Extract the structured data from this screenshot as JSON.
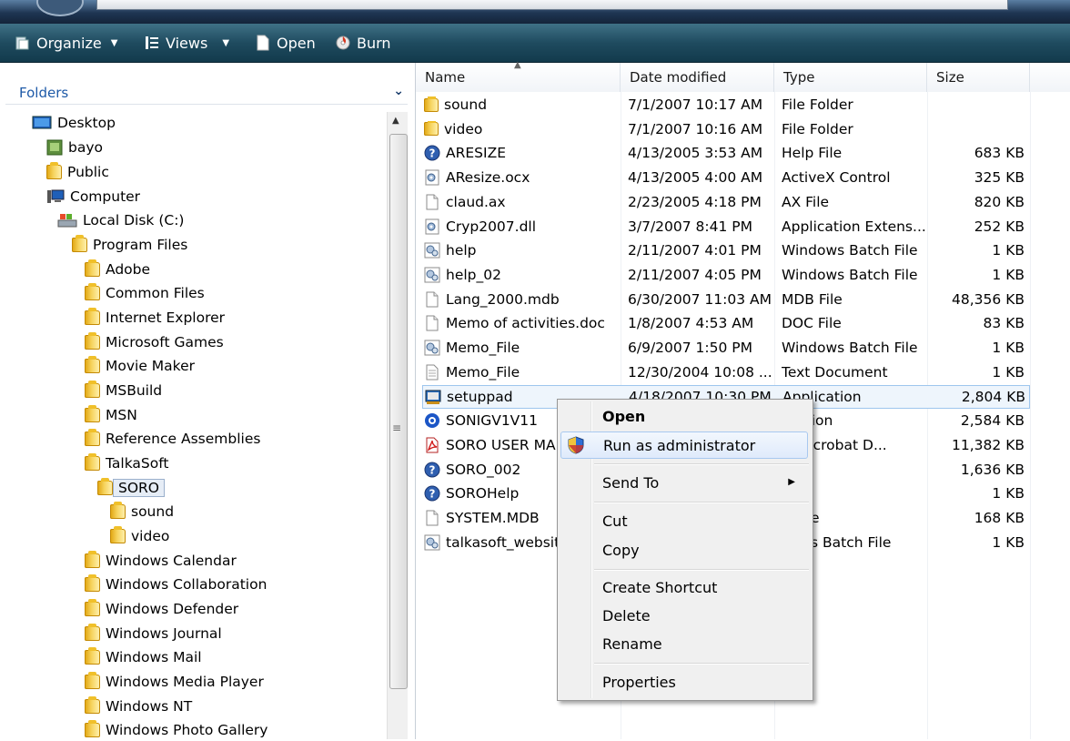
{
  "toolbar": {
    "organize": "Organize",
    "views": "Views",
    "open": "Open",
    "burn": "Burn"
  },
  "nav": {
    "header": "Folders",
    "items": [
      {
        "label": "Desktop",
        "icon": "desktop-icon"
      },
      {
        "label": "bayo",
        "icon": "user-icon"
      },
      {
        "label": "Public",
        "icon": "folder-icon"
      },
      {
        "label": "Computer",
        "icon": "computer-icon"
      },
      {
        "label": "Local Disk (C:)",
        "icon": "drive-icon"
      },
      {
        "label": "Program Files",
        "icon": "folder-icon"
      },
      {
        "label": "Adobe",
        "icon": "folder-icon"
      },
      {
        "label": "Common Files",
        "icon": "folder-icon"
      },
      {
        "label": "Internet Explorer",
        "icon": "folder-icon"
      },
      {
        "label": "Microsoft Games",
        "icon": "folder-icon"
      },
      {
        "label": "Movie Maker",
        "icon": "folder-icon"
      },
      {
        "label": "MSBuild",
        "icon": "folder-icon"
      },
      {
        "label": "MSN",
        "icon": "folder-icon"
      },
      {
        "label": "Reference Assemblies",
        "icon": "folder-icon"
      },
      {
        "label": "TalkaSoft",
        "icon": "folder-icon"
      },
      {
        "label": "SORO",
        "icon": "folder-icon"
      },
      {
        "label": "sound",
        "icon": "folder-icon"
      },
      {
        "label": "video",
        "icon": "folder-icon"
      },
      {
        "label": "Windows Calendar",
        "icon": "folder-icon"
      },
      {
        "label": "Windows Collaboration",
        "icon": "folder-icon"
      },
      {
        "label": "Windows Defender",
        "icon": "folder-icon"
      },
      {
        "label": "Windows Journal",
        "icon": "folder-icon"
      },
      {
        "label": "Windows Mail",
        "icon": "folder-icon"
      },
      {
        "label": "Windows Media Player",
        "icon": "folder-icon"
      },
      {
        "label": "Windows NT",
        "icon": "folder-icon"
      },
      {
        "label": "Windows Photo Gallery",
        "icon": "folder-icon"
      }
    ]
  },
  "columns": {
    "name": "Name",
    "date": "Date modified",
    "type": "Type",
    "size": "Size"
  },
  "files": [
    {
      "name": "sound",
      "date": "7/1/2007 10:17 AM",
      "type": "File Folder",
      "size": "",
      "icon": "folder-icon"
    },
    {
      "name": "video",
      "date": "7/1/2007 10:16 AM",
      "type": "File Folder",
      "size": "",
      "icon": "folder-icon"
    },
    {
      "name": "ARESIZE",
      "date": "4/13/2005 3:53 AM",
      "type": "Help File",
      "size": "683 KB",
      "icon": "help-icon"
    },
    {
      "name": "AResize.ocx",
      "date": "4/13/2005 4:00 AM",
      "type": "ActiveX Control",
      "size": "325 KB",
      "icon": "gear-file-icon"
    },
    {
      "name": "claud.ax",
      "date": "2/23/2005 4:18 PM",
      "type": "AX File",
      "size": "820 KB",
      "icon": "blank-file-icon"
    },
    {
      "name": "Cryp2007.dll",
      "date": "3/7/2007 8:41 PM",
      "type": "Application Extens...",
      "size": "252 KB",
      "icon": "gear-file-icon"
    },
    {
      "name": "help",
      "date": "2/11/2007 4:01 PM",
      "type": "Windows Batch File",
      "size": "1 KB",
      "icon": "batch-icon"
    },
    {
      "name": "help_02",
      "date": "2/11/2007 4:05 PM",
      "type": "Windows Batch File",
      "size": "1 KB",
      "icon": "batch-icon"
    },
    {
      "name": "Lang_2000.mdb",
      "date": "6/30/2007 11:03 AM",
      "type": "MDB File",
      "size": "48,356 KB",
      "icon": "blank-file-icon"
    },
    {
      "name": "Memo of activities.doc",
      "date": "1/8/2007 4:53 AM",
      "type": "DOC File",
      "size": "83 KB",
      "icon": "blank-file-icon"
    },
    {
      "name": "Memo_File",
      "date": "6/9/2007 1:50 PM",
      "type": "Windows Batch File",
      "size": "1 KB",
      "icon": "batch-icon"
    },
    {
      "name": "Memo_File",
      "date": "12/30/2004 10:08 ...",
      "type": "Text Document",
      "size": "1 KB",
      "icon": "text-file-icon"
    },
    {
      "name": "setuppad",
      "date": "4/18/2007 10:30 PM",
      "type": "Application",
      "size": "2,804 KB",
      "icon": "setup-icon"
    },
    {
      "name": "SONIGV1V11",
      "date": "",
      "type": "lication",
      "size": "2,584 KB",
      "icon": "app-icon"
    },
    {
      "name": "SORO USER MA",
      "date": "",
      "type": "be Acrobat D...",
      "size": "11,382 KB",
      "icon": "pdf-icon"
    },
    {
      "name": "SORO_002",
      "date": "",
      "type": "File",
      "size": "1,636 KB",
      "icon": "help-icon"
    },
    {
      "name": "SOROHelp",
      "date": "",
      "type": "File",
      "size": "1 KB",
      "icon": "help-icon"
    },
    {
      "name": "SYSTEM.MDB",
      "date": "",
      "type": "B File",
      "size": "168 KB",
      "icon": "blank-file-icon"
    },
    {
      "name": "talkasoft_websit",
      "date": "",
      "type": "dows Batch File",
      "size": "1 KB",
      "icon": "batch-icon"
    }
  ],
  "context_menu": {
    "open": "Open",
    "run_as_admin": "Run as administrator",
    "send_to": "Send To",
    "cut": "Cut",
    "copy": "Copy",
    "create_shortcut": "Create Shortcut",
    "delete": "Delete",
    "rename": "Rename",
    "properties": "Properties"
  }
}
